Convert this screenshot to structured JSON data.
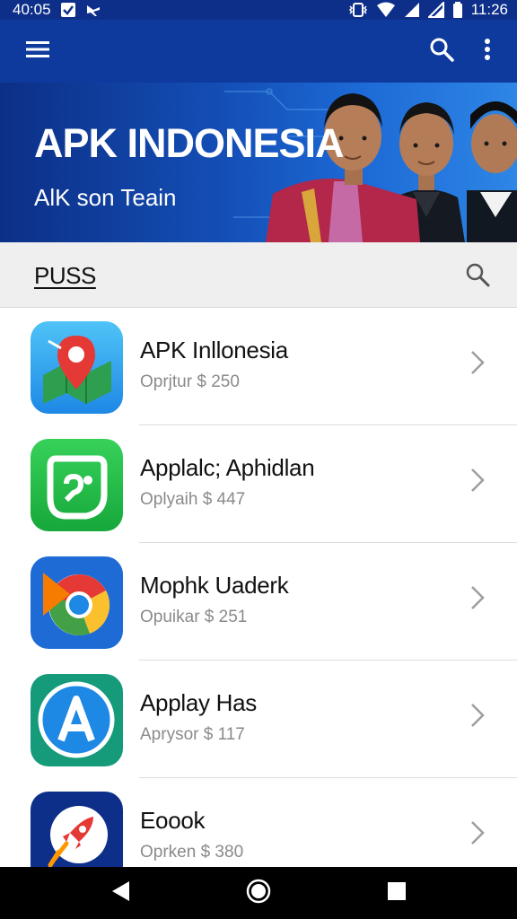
{
  "status_bar": {
    "time_left": "40:05",
    "time_right": "11:26"
  },
  "app_bar": {
    "icons": [
      "menu-icon",
      "search-icon",
      "more-vert-icon"
    ]
  },
  "banner": {
    "title": "APK INDONESIA",
    "subtitle": "AlK son Teain"
  },
  "section": {
    "title": "PUSS"
  },
  "apps": [
    {
      "name": "APK Inllonesia",
      "meta": "Oprjtur $ 250",
      "icon": "map-pin-icon"
    },
    {
      "name": "Applalc; Aphidlan",
      "meta": "Oplyaih $ 447",
      "icon": "chat-bubble-icon"
    },
    {
      "name": "Mophk Uaderk",
      "meta": "Opuikar $ 251",
      "icon": "browser-icon"
    },
    {
      "name": "Applay Has",
      "meta": "Aprysor $ 117",
      "icon": "app-store-icon"
    },
    {
      "name": "Eoook",
      "meta": "Oprken $ 380",
      "icon": "rocket-icon"
    }
  ],
  "colors": {
    "status_bar": "#0d2f8a",
    "app_bar": "#0e3a9e",
    "section_bg": "#efefef",
    "nav_bar": "#000000"
  }
}
